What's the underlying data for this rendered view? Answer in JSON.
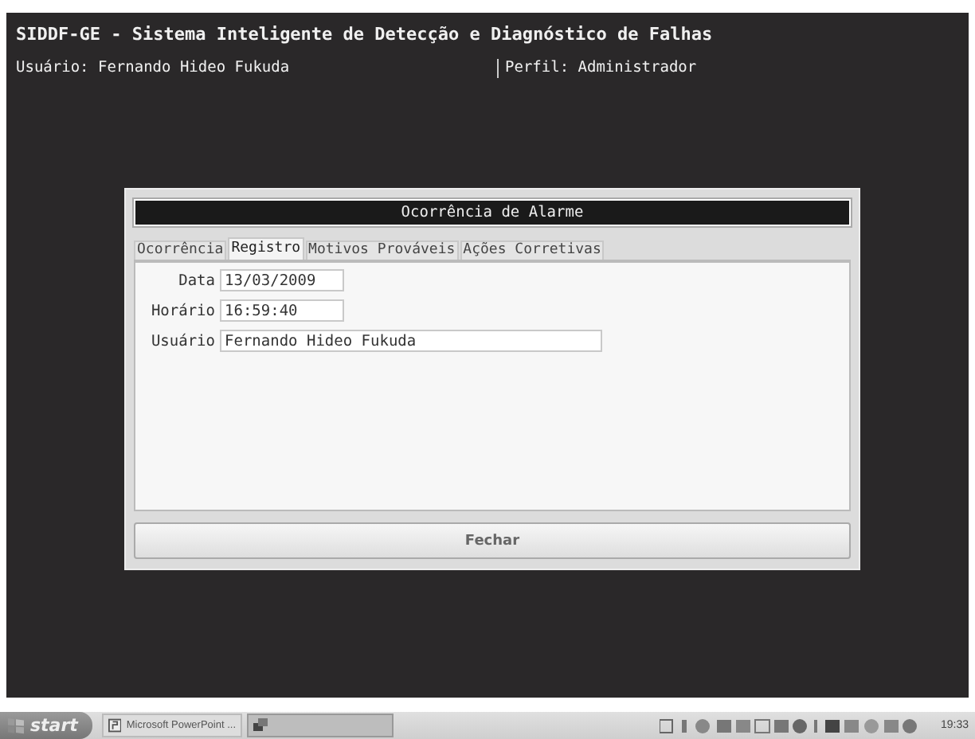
{
  "app": {
    "title": "SIDDF-GE - Sistema Inteligente de Detecção e Diagnóstico de Falhas",
    "user": "Usuário: Fernando Hideo Fukuda",
    "profile": "Perfil: Administrador"
  },
  "dialog": {
    "title": "Ocorrência de Alarme",
    "tabs": [
      {
        "label": "Ocorrência",
        "selected": false
      },
      {
        "label": "Registro",
        "selected": true
      },
      {
        "label": "Motivos Prováveis",
        "selected": false
      },
      {
        "label": "Ações Corretivas",
        "selected": false
      }
    ],
    "fields": [
      {
        "label": "Data",
        "value": "13/03/2009",
        "kind": "short"
      },
      {
        "label": "Horário",
        "value": "16:59:40",
        "kind": "short"
      },
      {
        "label": "Usuário",
        "value": "Fernando Hideo Fukuda",
        "kind": "long"
      }
    ],
    "button": "Fechar"
  },
  "taskbar": {
    "start": "start",
    "tasks": [
      {
        "label": "Microsoft PowerPoint ...",
        "selected": false
      },
      {
        "selected": true
      }
    ],
    "clock": "19:33"
  }
}
